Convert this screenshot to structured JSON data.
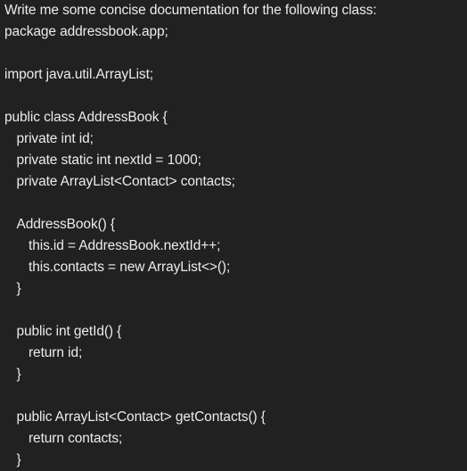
{
  "message": {
    "lines": [
      {
        "text": "Write me some concise documentation for the following class:",
        "indent": 0
      },
      {
        "text": "package addressbook.app;",
        "indent": 0
      },
      {
        "text": "",
        "indent": 0
      },
      {
        "text": "import java.util.ArrayList;",
        "indent": 0
      },
      {
        "text": "",
        "indent": 0
      },
      {
        "text": "public class AddressBook {",
        "indent": 0
      },
      {
        "text": "private int id;",
        "indent": 1
      },
      {
        "text": "private static int nextId = 1000;",
        "indent": 1
      },
      {
        "text": "private ArrayList<Contact> contacts;",
        "indent": 1
      },
      {
        "text": "",
        "indent": 0
      },
      {
        "text": "AddressBook() {",
        "indent": 1
      },
      {
        "text": "this.id = AddressBook.nextId++;",
        "indent": 2
      },
      {
        "text": "this.contacts = new ArrayList<>();",
        "indent": 2
      },
      {
        "text": "}",
        "indent": 1
      },
      {
        "text": "",
        "indent": 0
      },
      {
        "text": "public int getId() {",
        "indent": 1
      },
      {
        "text": "return id;",
        "indent": 2
      },
      {
        "text": "}",
        "indent": 1
      },
      {
        "text": "",
        "indent": 0
      },
      {
        "text": "public ArrayList<Contact> getContacts() {",
        "indent": 1
      },
      {
        "text": "return contacts;",
        "indent": 2
      },
      {
        "text": "}",
        "indent": 1
      }
    ]
  }
}
